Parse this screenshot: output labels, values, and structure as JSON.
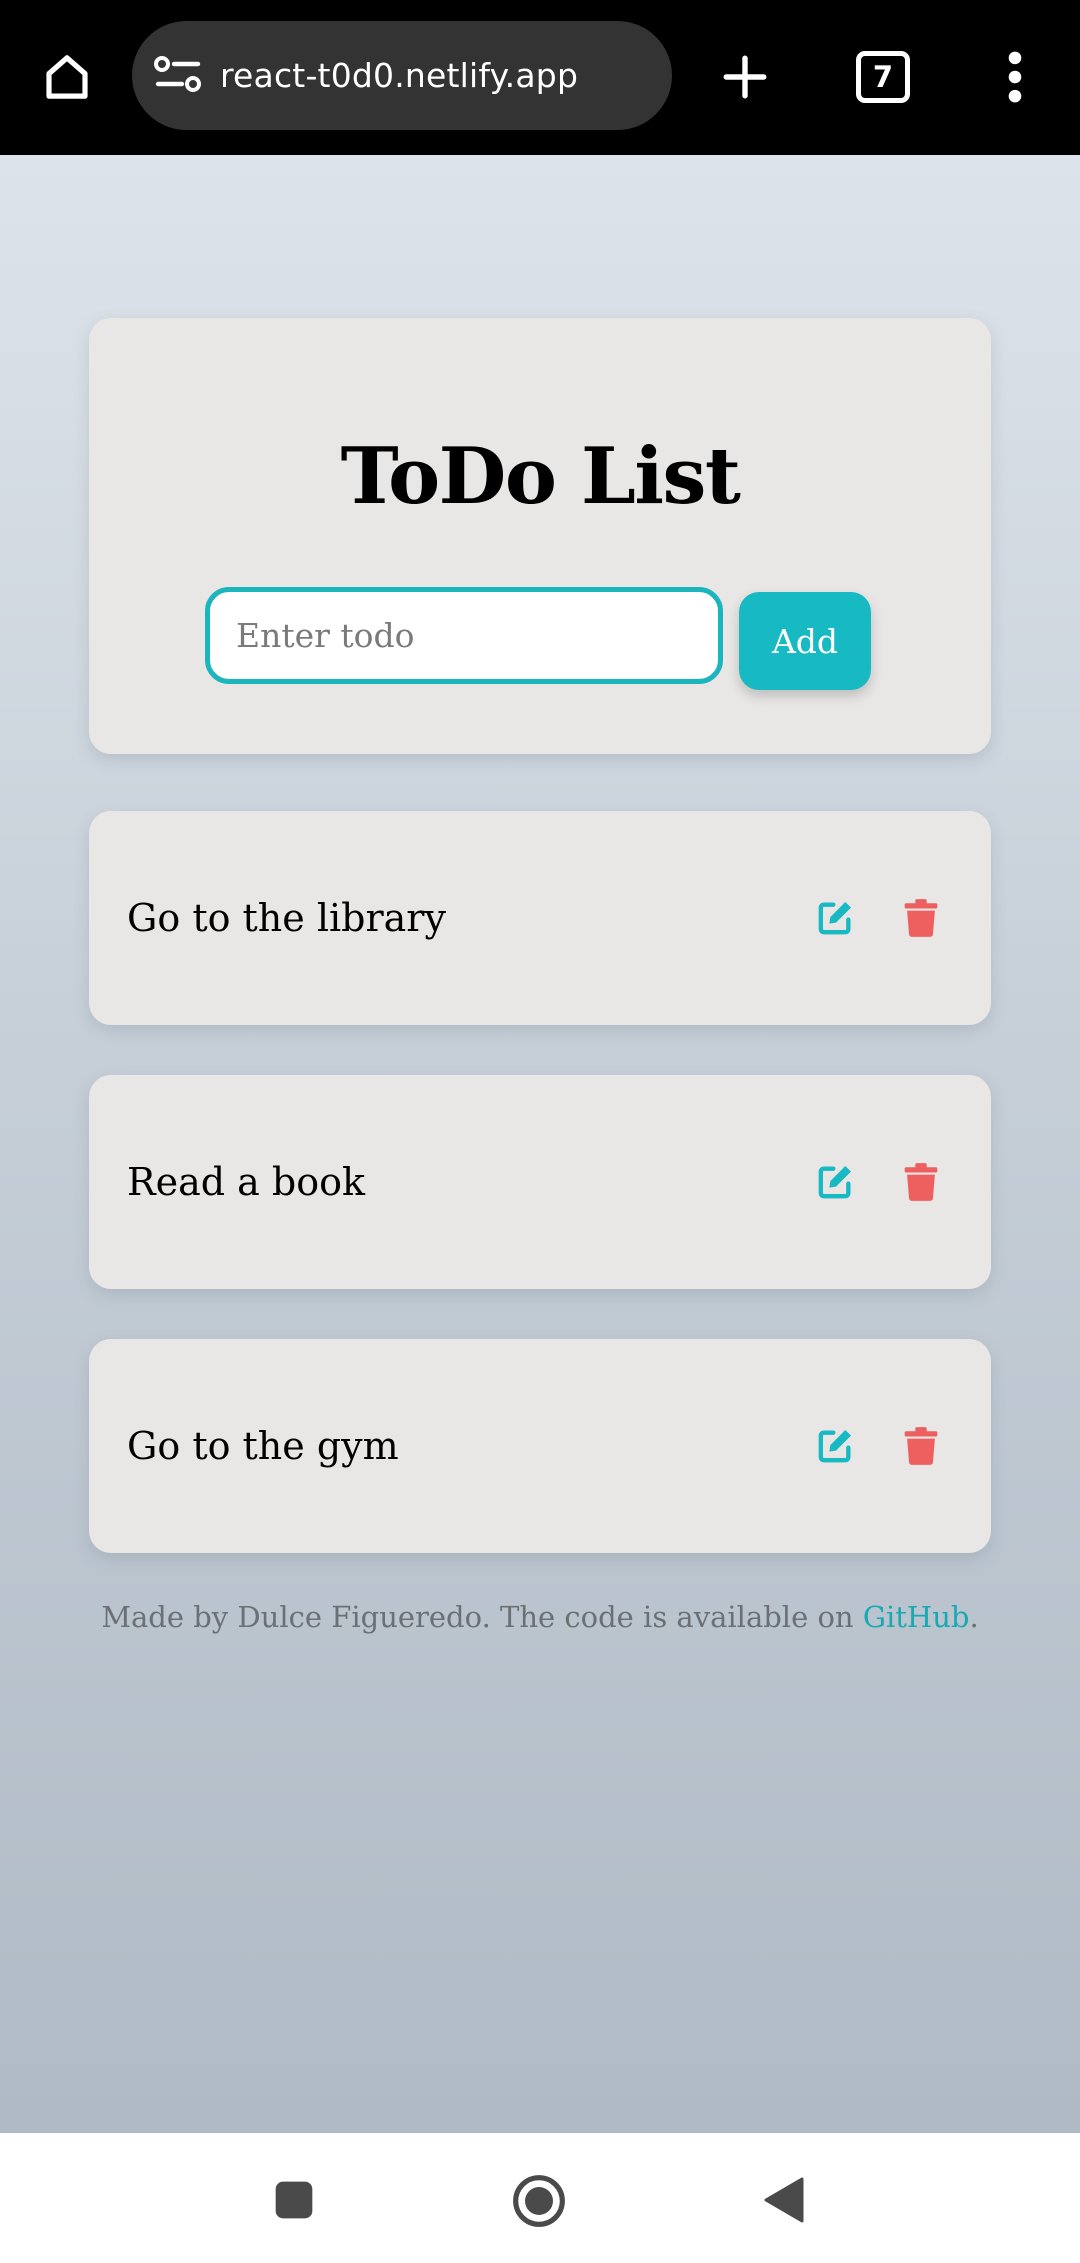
{
  "browser": {
    "url": "react-t0d0.netlify.app",
    "tab_count": "7",
    "home_icon": "home-icon",
    "site_info_icon": "site-settings-icon",
    "new_tab_icon": "plus-icon",
    "menu_icon": "more-vertical-icon"
  },
  "app": {
    "title": "ToDo List",
    "input": {
      "placeholder": "Enter todo",
      "value": ""
    },
    "add_label": "Add",
    "accent_color": "#17b9c2",
    "delete_color": "#ee5f5f",
    "todos": [
      {
        "text": "Go to the library"
      },
      {
        "text": "Read a book"
      },
      {
        "text": "Go to the gym"
      }
    ]
  },
  "footer": {
    "prefix": "Made by Dulce Figueredo. The code is available on ",
    "link_text": "GitHub",
    "suffix": "."
  },
  "nav": {
    "recents_icon": "square-icon",
    "home_icon": "circle-home-icon",
    "back_icon": "back-triangle-icon"
  }
}
